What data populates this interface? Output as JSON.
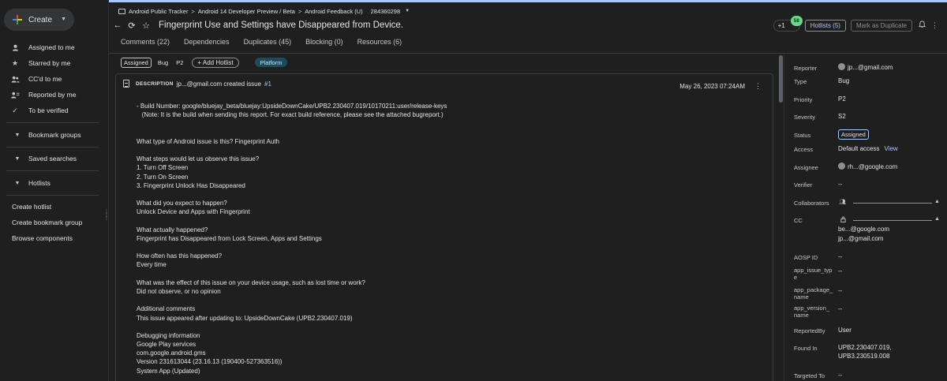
{
  "sidebar": {
    "create_label": "Create",
    "items": [
      {
        "label": "Assigned to me",
        "icon": "person-icon"
      },
      {
        "label": "Starred by me",
        "icon": "star-icon"
      },
      {
        "label": "CC'd to me",
        "icon": "people-icon"
      },
      {
        "label": "Reported by me",
        "icon": "person-list-icon"
      },
      {
        "label": "To be verified",
        "icon": "check-icon"
      }
    ],
    "groups": [
      "Bookmark groups",
      "Saved searches",
      "Hotlists"
    ],
    "links": [
      "Create hotlist",
      "Create bookmark group",
      "Browse components"
    ]
  },
  "breadcrumb": {
    "items": [
      "Android Public Tracker",
      "Android 14 Developer Preview / Beta",
      "Android Feedback (U)"
    ],
    "issue_id": "284360298"
  },
  "header": {
    "title": "Fingerprint Use and Settings have Disappeared from Device.",
    "plus_one_label": "+1",
    "plus_one_count": "58",
    "hotlists_label": "Hotlists (5)",
    "duplicate_label": "Mark as Duplicate"
  },
  "tabs": [
    "Comments (22)",
    "Dependencies",
    "Duplicates (45)",
    "Blocking (0)",
    "Resources (6)"
  ],
  "chips": {
    "status": "Assigned",
    "type": "Bug",
    "priority": "P2",
    "add_hotlist": "+ Add Hotlist",
    "component": "Platform"
  },
  "description": {
    "label": "DESCRIPTION",
    "author": "jp...@gmail.com created issue",
    "issue_num": "#1",
    "date": "May 26, 2023 07:24AM",
    "lines": [
      "- Build Number: google/bluejay_beta/bluejay:UpsideDownCake/UPB2.230407.019/10170211:user/release-keys",
      "   (Note: It is the build when sending this report. For exact build reference, please see the attached bugreport.)",
      "",
      "",
      "What type of Android issue is this? Fingerprint Auth",
      "",
      "What steps would let us observe this issue?",
      "1. Turn Off Screen",
      "2. Turn On Screen",
      "3. Fingerprint Unlock Has Disappeared",
      "",
      "What did you expect to happen?",
      "Unlock Device and Apps with Fingerprint",
      "",
      "What actually happened?",
      "Fingerprint has Disappeared from Lock Screen, Apps and Settings",
      "",
      "How often has this happened?",
      "Every time",
      "",
      "What was the effect of this issue on your device usage, such as lost time or work?",
      "Did not observe, or no opinion",
      "",
      "Additional comments",
      "This issue appeared after updating to: UpsideDownCake (UPB2.230407.019)",
      "",
      "Debugging information",
      "Google Play services",
      "com.google.android.gms",
      "Version 231613044 (23.16.13 (190400-527363516))",
      "System App (Updated)"
    ]
  },
  "meta": {
    "reporter": {
      "key": "Reporter",
      "value": "jp...@gmail.com"
    },
    "type": {
      "key": "Type",
      "value": "Bug"
    },
    "priority": {
      "key": "Priority",
      "value": "P2"
    },
    "severity": {
      "key": "Severity",
      "value": "S2"
    },
    "status": {
      "key": "Status",
      "value": "Assigned"
    },
    "access": {
      "key": "Access",
      "value": "Default access",
      "link": "View"
    },
    "assignee": {
      "key": "Assignee",
      "value": "rh...@google.com"
    },
    "verifier": {
      "key": "Verifier",
      "value": "--"
    },
    "collaborators": {
      "key": "Collaborators"
    },
    "cc": {
      "key": "CC",
      "values": [
        "be...@google.com",
        "jp...@gmail.com"
      ]
    },
    "aosp_id": {
      "key": "AOSP ID",
      "value": "--"
    },
    "app_issue_type": {
      "key": "app_issue_typ\ne",
      "value": "--"
    },
    "app_package_name": {
      "key": "app_package_\nname",
      "value": "--"
    },
    "app_version_name": {
      "key": "app_version_\nname",
      "value": "--"
    },
    "reported_by": {
      "key": "ReportedBy",
      "value": "User"
    },
    "found_in": {
      "key": "Found In",
      "values": [
        "UPB2.230407.019,",
        "UPB3.230519.008"
      ]
    },
    "targeted_to": {
      "key": "Targeted To",
      "value": "--"
    }
  },
  "colors": {
    "accent": "#a8c7fa",
    "background": "#1f1f1f",
    "plus_one_badge": "#6dd58c",
    "platform_chip": "#1e4a5a"
  }
}
